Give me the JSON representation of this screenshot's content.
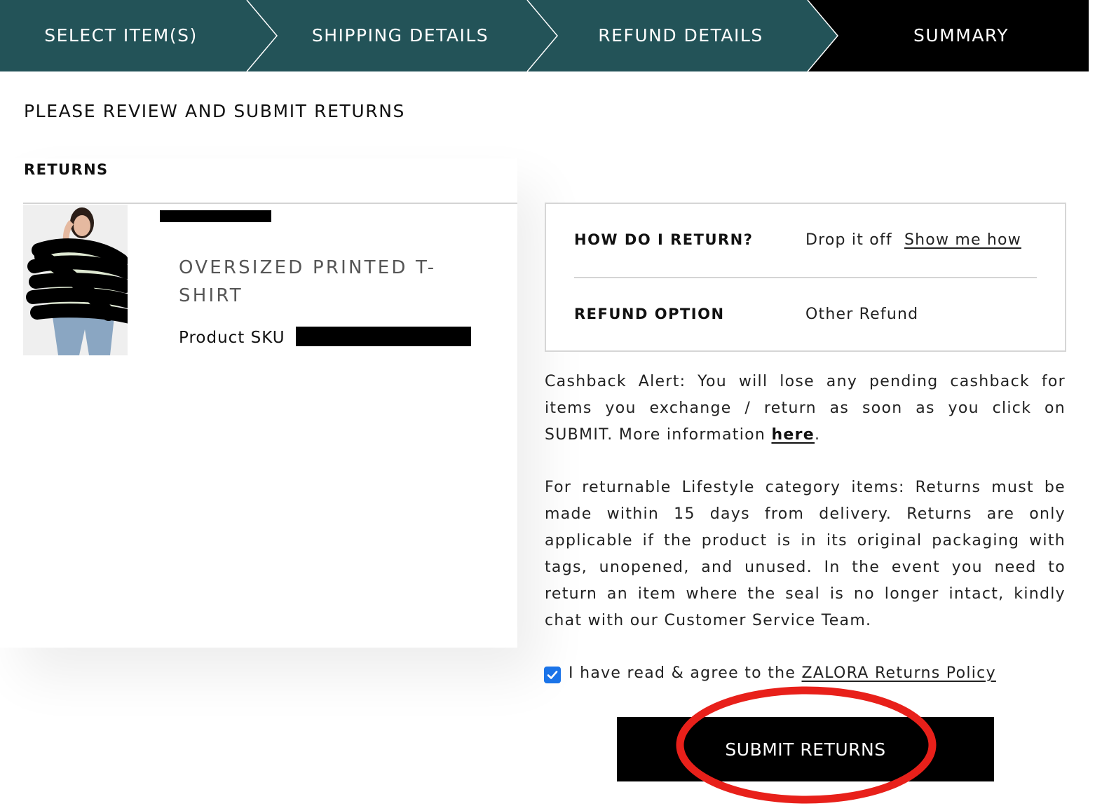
{
  "stepper": {
    "steps": [
      {
        "label": "SELECT ITEM(S)",
        "state": "done"
      },
      {
        "label": "SHIPPING DETAILS",
        "state": "done"
      },
      {
        "label": "REFUND DETAILS",
        "state": "done"
      },
      {
        "label": "SUMMARY",
        "state": "current"
      }
    ],
    "colors": {
      "done": "#235358",
      "current": "#000000"
    }
  },
  "page": {
    "title": "PLEASE REVIEW AND SUBMIT RETURNS"
  },
  "returns": {
    "heading": "RETURNS",
    "item": {
      "name": "OVERSIZED PRINTED T-SHIRT",
      "sku_label": "Product SKU"
    }
  },
  "summary": {
    "how_label": "HOW DO I RETURN?",
    "how_value": "Drop it off",
    "how_link": "Show me how",
    "refund_label": "REFUND OPTION",
    "refund_value": "Other Refund"
  },
  "notices": {
    "cashback_text": "Cashback Alert: You will lose any pending cashback for items you exchange / return as soon as you click on SUBMIT. More information ",
    "cashback_link": "here",
    "lifestyle_text": "For returnable Lifestyle category items: Returns must be made within 15 days from delivery. Returns are only applicable if the product is in its original packaging with tags, unopened, and unused. In the event you need to return an item where the seal is no longer intact, kindly chat with our Customer Service Team."
  },
  "agreement": {
    "text": "I have read & agree to the ",
    "link": "ZALORA Returns Policy",
    "checked": true
  },
  "submit": {
    "label": "SUBMIT RETURNS"
  },
  "colors": {
    "accent": "#235358",
    "checkbox": "#1a73e8",
    "annotation": "#e8201a"
  }
}
